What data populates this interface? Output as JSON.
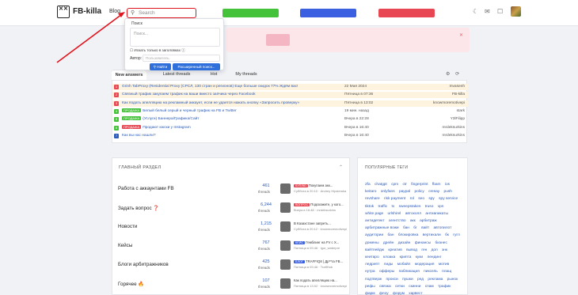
{
  "header": {
    "logo_mark": "x x\n:( —",
    "site_name": "FB-killa",
    "nav_blog": "Blog",
    "search_placeholder": "Search"
  },
  "search_dropdown": {
    "title": "Поиск",
    "query_placeholder": "Поиск...",
    "titles_only_label": "Искать только в заголовках",
    "author_label": "Автор:",
    "author_placeholder": "Пользователь",
    "find_button": "Найти",
    "advanced_button": "Расширенный поиск..."
  },
  "tabs": [
    {
      "label": "New answers"
    },
    {
      "label": "Latest threads"
    },
    {
      "label": "Hot"
    },
    {
      "label": "My threads"
    }
  ],
  "threads": [
    {
      "num": "1",
      "num_color": "#e84652",
      "prefix": "",
      "prefix_color": "",
      "title": "Grinh TabProxy (Residential Proxy (СРСЛ, 130 стран и регионов) Еще больше скидок 77% Ждём вас!",
      "date": "22 Мая 2024",
      "user": "Invasenh",
      "pinned": true
    },
    {
      "num": "2",
      "num_color": "#e84652",
      "prefix": "",
      "prefix_color": "",
      "title": "Связный трафик закупаем трафик на ваши вместо запчика через Facebook",
      "date": "Пятница в 07:36",
      "user": "FB-killa",
      "pinned": true
    },
    {
      "num": "3",
      "num_color": "#e84652",
      "prefix": "",
      "prefix_color": "",
      "title": "Как подать апелляцию на рекламный аккаунт, если не удается нажать кнопку «Запросить проверку»",
      "date": "Пятница в 13:02",
      "user": "knowmoremotivepi",
      "pinned": true
    },
    {
      "num": "4",
      "num_color": "#44c23a",
      "prefix": "ПРОДАЖА",
      "prefix_color": "#44c23a",
      "title": "Белый белый серый и черный трафик на FB и Twitter",
      "date": "19 мин. назад",
      "user": "stark",
      "pinned": false
    },
    {
      "num": "5",
      "num_color": "#44c23a",
      "prefix": "ПРОДАЖА",
      "prefix_color": "#44c23a",
      "title": "(Услуги) Баннера/Графика/Сайт",
      "date": "Вчера в 22:28",
      "user": "Y3lFilipp",
      "pinned": false
    },
    {
      "num": "6",
      "num_color": "#44c23a",
      "prefix": "ПРОДАЖА",
      "prefix_color": "#e84652",
      "title": "Продают юкски у Instagram",
      "date": "Вчера в 16:40",
      "user": "mrdeksurkins",
      "pinned": false
    },
    {
      "num": "7",
      "num_color": "#2b5ab8",
      "prefix": "",
      "prefix_color": "",
      "title": "Как вы нас нашли?",
      "date": "Вчера в 16:40",
      "user": "mrdeksurkins",
      "pinned": false
    }
  ],
  "main_section": {
    "heading": "ГЛАВНЫЙ РАЗДЕЛ",
    "categories": [
      {
        "name": "Работа с аккаунтами FB",
        "count": "461",
        "count_label": "threads",
        "latest_badge": "КУПЛЮ",
        "latest_badge_color": "#e84652",
        "latest_title": "Покупаем акк...",
        "latest_meta": "Суббота в 20:10 · Andrey Hipstemka"
      },
      {
        "name": "Задать вопрос ❓",
        "count": "6,244",
        "count_label": "threads",
        "latest_badge": "ВОПРОС",
        "latest_badge_color": "#e84652",
        "latest_title": "Подскажите, у кого...",
        "latest_meta": "Вчера в 16:48 · mrdeksurkins"
      },
      {
        "name": "Новости",
        "count": "1,215",
        "count_label": "threads",
        "latest_badge": "",
        "latest_badge_color": "",
        "latest_title": "В Казахстане запреть...",
        "latest_meta": "Суббота в 20:12 · knowmoremotivepi"
      },
      {
        "name": "Кейсы",
        "count": "767",
        "count_label": "threads",
        "latest_badge": "КЕЙС",
        "latest_badge_color": "#3a5fe0",
        "latest_title": "Гемблинг на FV с Х...",
        "latest_meta": "Пятница в 09:46 · igor_waterpre"
      },
      {
        "name": "Блоги арбитражников",
        "count": "425",
        "count_label": "threads",
        "latest_badge": "БЛОГ",
        "latest_badge_color": "#3a5fe0",
        "latest_title": "TRAFFIQ8 | Др**га FB...",
        "latest_meta": "Пятница в 09:46 · TraffHub"
      },
      {
        "name": "Горячее 🔥",
        "count": "107",
        "count_label": "threads",
        "latest_badge": "",
        "latest_badge_color": "",
        "latest_title": "Как подать апелляцию на...",
        "latest_meta": "Пятница в 13:02 · knowmoremotivepi"
      }
    ]
  },
  "tags_section": {
    "heading": "ПОПУЛЯРНЫЕ ТЕГИ",
    "tags": [
      "2fa",
      "chatgpt",
      "cpm",
      "ctr",
      "fingerprint",
      "fbam",
      "ios",
      "keitaro",
      "onlyfans",
      "paypal",
      "policy",
      "cresay",
      "push",
      "revshare",
      "risk payment",
      "rol",
      "seo",
      "spy",
      "spy service",
      "tiktok",
      "traffic",
      "tx",
      "sweepstakes",
      "truso",
      "vpn",
      "white page",
      "urlshirel",
      "автохолл",
      "антиапикаты",
      "антидетект",
      "агентство",
      "акк",
      "арбитраж",
      "арбитражные вожи",
      "бан",
      "бг",
      "вайт",
      "автопилот",
      "аудитории",
      "бан",
      "блокировка",
      "вертикали",
      "бк",
      "гугл",
      "домены",
      "дрейн",
      "дизайн",
      "финансы",
      "бизнес",
      "вайтпейдж",
      "креатив",
      "вывод",
      "ген",
      "доп",
      "знк",
      "кеитаро",
      "клоака",
      "крипта",
      "куки",
      "лендинг",
      "ледрипт",
      "лиды",
      "мобайл",
      "модерация",
      "мотив",
      "нутра",
      "офферы",
      "пабликация",
      "пиксель",
      "плащ",
      "подтверж",
      "прокси",
      "пушки",
      "ред",
      "реклама",
      "рынок",
      "рефы",
      "связка",
      "сетки",
      "скинни",
      "спам",
      "трафик",
      "фарм",
      "флоу",
      "форум",
      "харвест"
    ]
  },
  "colors": {
    "accent": "#2f6fdb",
    "highlight_red": "#e0141e",
    "banner_green": "#44c23a",
    "banner_blue": "#3a5fe0",
    "banner_red": "#e84652"
  }
}
